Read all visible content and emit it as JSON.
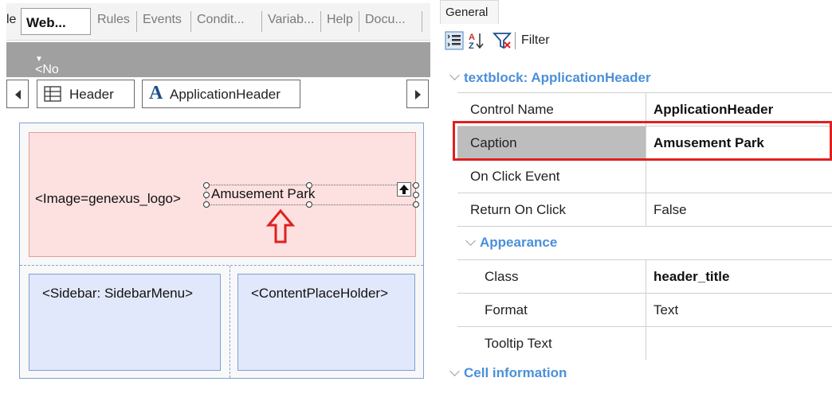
{
  "left_panel": {
    "tabs": {
      "partial": "le",
      "active": "Web...",
      "others": [
        "Rules",
        "Events",
        "Condit...",
        "Variab...",
        "Help",
        "Docu..."
      ]
    },
    "action_group": "<No action group selected>",
    "breadcrumb": {
      "items": [
        {
          "label": "Header",
          "icon": "table-icon"
        },
        {
          "label": "ApplicationHeader",
          "icon": "textblock-icon"
        }
      ]
    },
    "canvas": {
      "image_placeholder": "<Image=genexus_logo>",
      "caption_text": "Amusement Park",
      "sidebar_placeholder": "<Sidebar: SidebarMenu>",
      "content_placeholder": "<ContentPlaceHolder>"
    }
  },
  "right_panel": {
    "tab": "General",
    "toolbar": {
      "filter_label": "Filter"
    },
    "section_title": "textblock: ApplicationHeader",
    "properties": [
      {
        "name": "Control Name",
        "value": "ApplicationHeader",
        "bold": true
      },
      {
        "name": "Caption",
        "value": "Amusement Park",
        "bold": true,
        "selected": true
      },
      {
        "name": "On Click Event",
        "value": ""
      },
      {
        "name": "Return On Click",
        "value": "False"
      }
    ],
    "appearance": {
      "title": "Appearance",
      "properties": [
        {
          "name": "Class",
          "value": "header_title",
          "bold": true
        },
        {
          "name": "Format",
          "value": "Text"
        },
        {
          "name": "Tooltip Text",
          "value": ""
        }
      ]
    },
    "cell_info_title": "Cell information"
  },
  "colors": {
    "section_title": "#4a90d9",
    "highlight": "#e02020",
    "header_region": "#fde0e0",
    "placeholder_region": "#e2e8fb",
    "action_bar": "#a0a0a0"
  }
}
